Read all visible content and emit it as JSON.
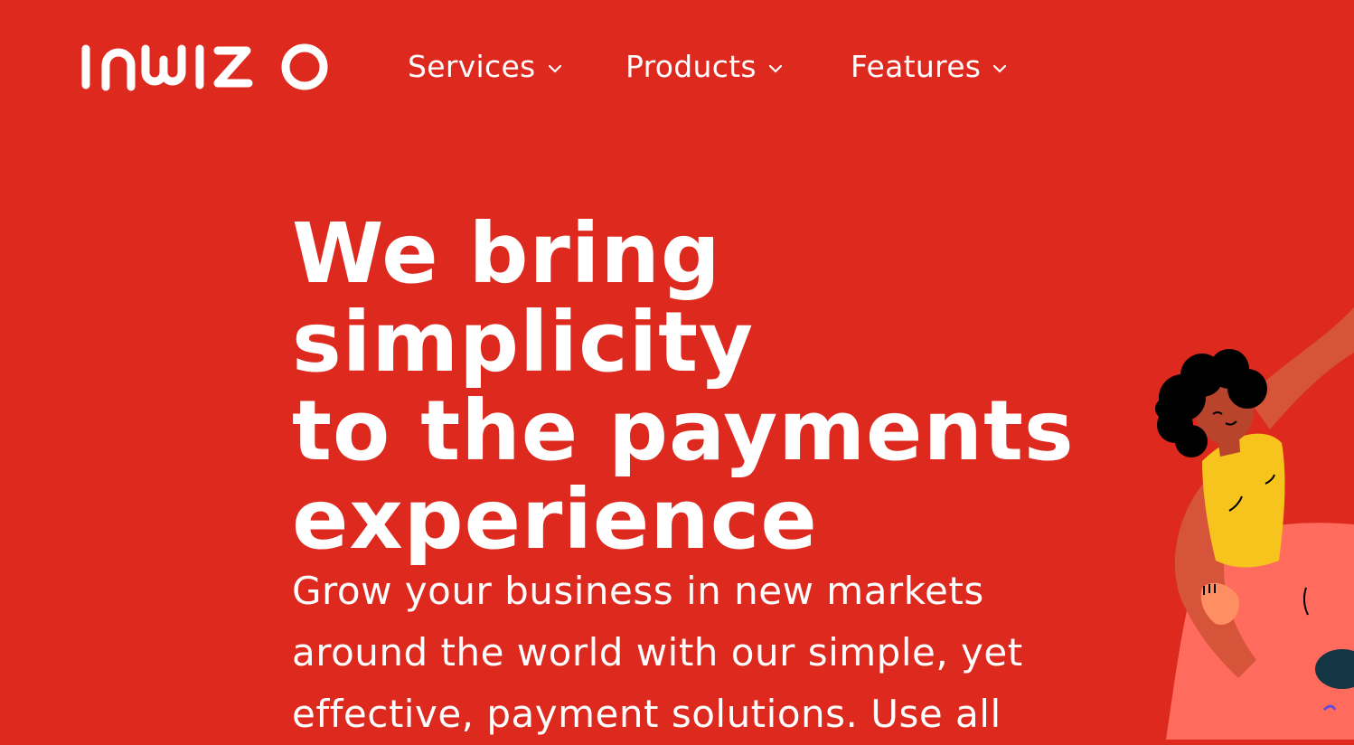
{
  "brand": {
    "name": "INWIZO",
    "background": "#dd291e",
    "text_color": "#ffffff"
  },
  "nav": {
    "items": [
      {
        "label": "Services",
        "icon": "chevron-down-icon"
      },
      {
        "label": "Products",
        "icon": "chevron-down-icon"
      },
      {
        "label": "Features",
        "icon": "chevron-down-icon"
      }
    ]
  },
  "hero": {
    "headline_lines": [
      "We bring simplicity",
      "to the payments",
      "experience"
    ],
    "subtext_lines": [
      "Grow your business in new markets",
      "around the world with our simple, yet",
      "effective, payment solutions. Use all"
    ]
  },
  "illustration": {
    "icon": "dancing-person-illustration",
    "colors": {
      "skin": "#d5543a",
      "hair": "#000000",
      "shirt": "#f7c31d",
      "skirt": "#ff6b5c"
    }
  }
}
